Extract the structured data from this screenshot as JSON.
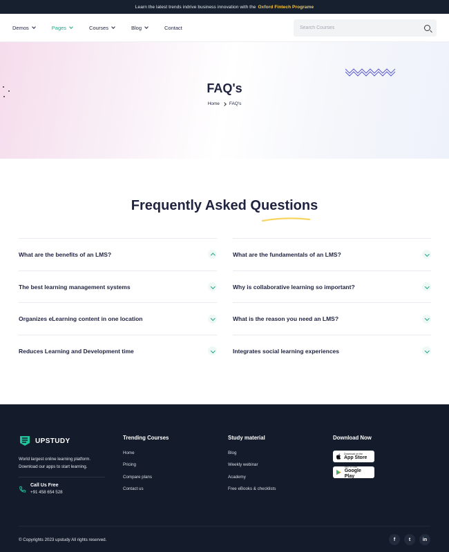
{
  "topbar": {
    "text": "Learn the latest trends indrive business innovation with the",
    "highlight": "Oxford Fintech Programe"
  },
  "nav": {
    "items": [
      {
        "label": "Demos",
        "dropdown": true,
        "active": false
      },
      {
        "label": "Pages",
        "dropdown": true,
        "active": true
      },
      {
        "label": "Courses",
        "dropdown": true,
        "active": false
      },
      {
        "label": "Blog",
        "dropdown": true,
        "active": false
      },
      {
        "label": "Contact",
        "dropdown": false,
        "active": false
      }
    ],
    "search_placeholder": "Search Courses"
  },
  "hero": {
    "title": "FAQ's",
    "breadcrumb": [
      "Home",
      "FAQ's"
    ]
  },
  "faq": {
    "heading": "Frequently Asked Questions",
    "left": [
      {
        "q": "What are the benefits of an LMS?",
        "open": true
      },
      {
        "q": "The best learning management systems",
        "open": false
      },
      {
        "q": "Organizes eLearning content in one location",
        "open": false
      },
      {
        "q": "Reduces Learning and Development time",
        "open": false
      }
    ],
    "right": [
      {
        "q": "What are the fundamentals of an LMS?",
        "open": false
      },
      {
        "q": "Why is collaborative learning so important?",
        "open": false
      },
      {
        "q": "What is the reason you need an LMS?",
        "open": false
      },
      {
        "q": "Integrates social learning experiences",
        "open": false
      }
    ]
  },
  "footer": {
    "brand": "UPSTUDY",
    "desc_line1": "World largest online learning platform.",
    "desc_line2": "Download our apps to start learning.",
    "call_label": "Call Us Free",
    "call_number": "+91 458 654 528",
    "trending": {
      "title": "Trending Courses",
      "links": [
        "Home",
        "Pricing",
        "Compare plans",
        "Contact us"
      ]
    },
    "study": {
      "title": "Study material",
      "links": [
        "Blog",
        "Weekly webinar",
        "Academy",
        "Free eBooks & checklists"
      ]
    },
    "download": {
      "title": "Download Now",
      "app_store_small": "Download on the",
      "app_store": "App Store",
      "google_small": "GET IT ON",
      "google": "Google Play"
    },
    "copyright": "© Copyrights 2023 upstudy All rights reserved.",
    "social": [
      "f",
      "t",
      "in"
    ]
  },
  "colors": {
    "accent": "#1fa78a",
    "dark": "#141c2b",
    "heading": "#1f2340",
    "highlight": "#f7c948"
  }
}
